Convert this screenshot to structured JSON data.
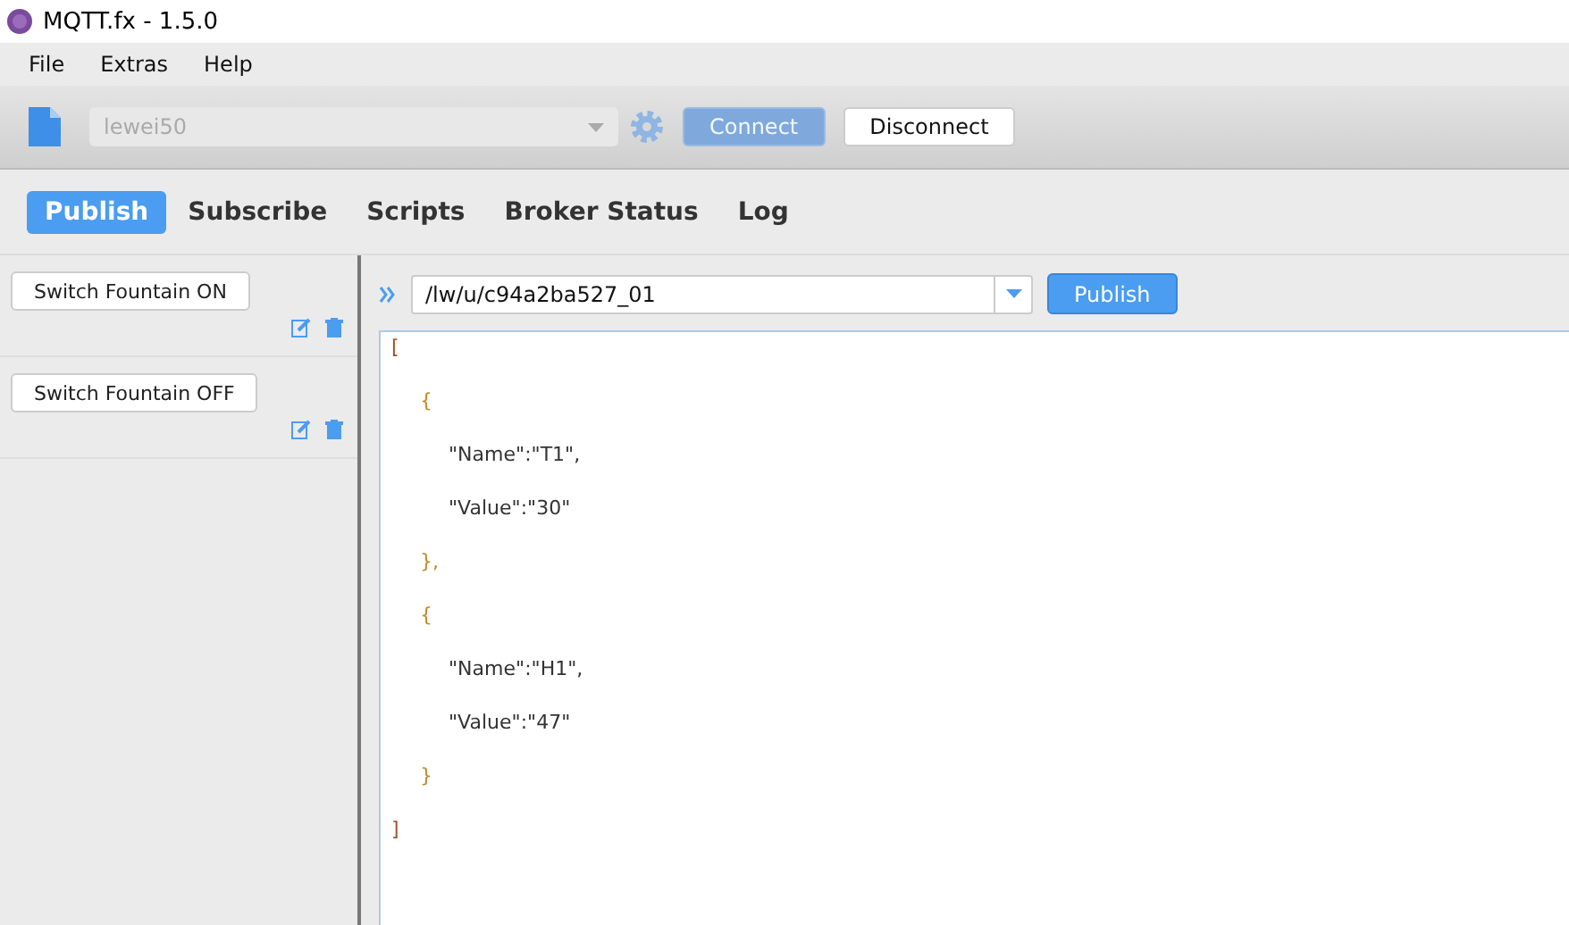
{
  "window": {
    "title": "MQTT.fx - 1.5.0"
  },
  "menu": [
    "File",
    "Extras",
    "Help"
  ],
  "toolbar": {
    "profile": "lewei50",
    "connect": {
      "label": "Connect",
      "disabled": true
    },
    "disconnect": {
      "label": "Disconnect",
      "disabled": false
    }
  },
  "tabs": [
    {
      "label": "Publish",
      "selected": true
    },
    {
      "label": "Subscribe",
      "selected": false
    },
    {
      "label": "Scripts",
      "selected": false
    },
    {
      "label": "Broker Status",
      "selected": false
    },
    {
      "label": "Log",
      "selected": false
    }
  ],
  "scripts": [
    {
      "label": "Switch Fountain ON"
    },
    {
      "label": "Switch Fountain OFF"
    }
  ],
  "topic": "/lw/u/c94a2ba527_01",
  "publish_button": "Publish",
  "payload": [
    {
      "text": "[",
      "children": [
        {
          "text": "{",
          "children": [
            {
              "text": "\"Name\":\"T1\","
            },
            {
              "text": "\"Value\":\"30\""
            }
          ]
        },
        {
          "text": "},"
        },
        {
          "text": "{",
          "children": [
            {
              "text": "\"Name\":\"H1\","
            },
            {
              "text": "\"Value\":\"47\""
            }
          ]
        },
        {
          "text": "}"
        }
      ]
    },
    {
      "text": "]"
    }
  ]
}
